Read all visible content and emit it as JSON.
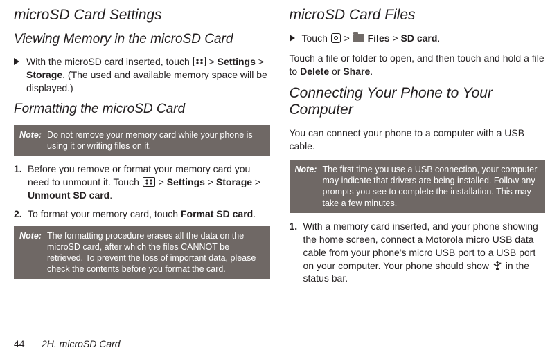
{
  "left": {
    "h2": "microSD Card Settings",
    "h3a": "Viewing Memory in the microSD Card",
    "bullet1_a": "With the microSD card inserted, touch ",
    "bullet1_b": " > ",
    "bullet1_settings": "Settings",
    "bullet1_c": " > ",
    "bullet1_storage": "Storage",
    "bullet1_d": ". (The used and available memory space will be displayed.)",
    "h3b": "Formatting the microSD Card",
    "note1_label": "Note:",
    "note1_msg": "Do not remove your memory card while your phone is using it or writing files on it.",
    "step1_num": "1.",
    "step1_a": "Before you remove or format your memory card you need to unmount it. Touch ",
    "step1_b": " > ",
    "step1_settings": "Settings",
    "step1_c": " > ",
    "step1_storage": "Storage",
    "step1_d": " > ",
    "step1_unmount": "Unmount SD card",
    "step1_e": ".",
    "step2_num": "2.",
    "step2_a": "To format your memory card, touch ",
    "step2_format": "Format SD card",
    "step2_b": ".",
    "note2_label": "Note:",
    "note2_msg": "The formatting procedure erases all the data on the microSD card, after which the files CANNOT be retrieved. To prevent the loss of important data, please check the contents before you format the card."
  },
  "right": {
    "h2": "microSD Card Files",
    "bullet1_a": "Touch ",
    "bullet1_b": " > ",
    "bullet1_files": "Files",
    "bullet1_c": " > ",
    "bullet1_sd": "SD card",
    "bullet1_d": ".",
    "openline_a": "Touch a file or folder to open, and then touch and hold a file to ",
    "openline_del": "Delete",
    "openline_b": " or ",
    "openline_share": "Share",
    "openline_c": ".",
    "h3": "Connecting Your Phone to Your Computer",
    "connect_intro": "You can connect your phone to a computer with a USB cable.",
    "note_label": "Note:",
    "note_msg": "The first time you use a USB connection, your computer may indicate that drivers are being installed. Follow any prompts you see to complete the installation. This may take a few minutes.",
    "step1_num": "1.",
    "step1_a": "With a memory card inserted, and your phone showing the home screen, connect a Motorola micro USB data cable from your phone's micro USB port to a USB port on your computer. Your phone should show ",
    "step1_b": " in the status bar."
  },
  "footer": {
    "page": "44",
    "section": "2H. microSD Card"
  }
}
